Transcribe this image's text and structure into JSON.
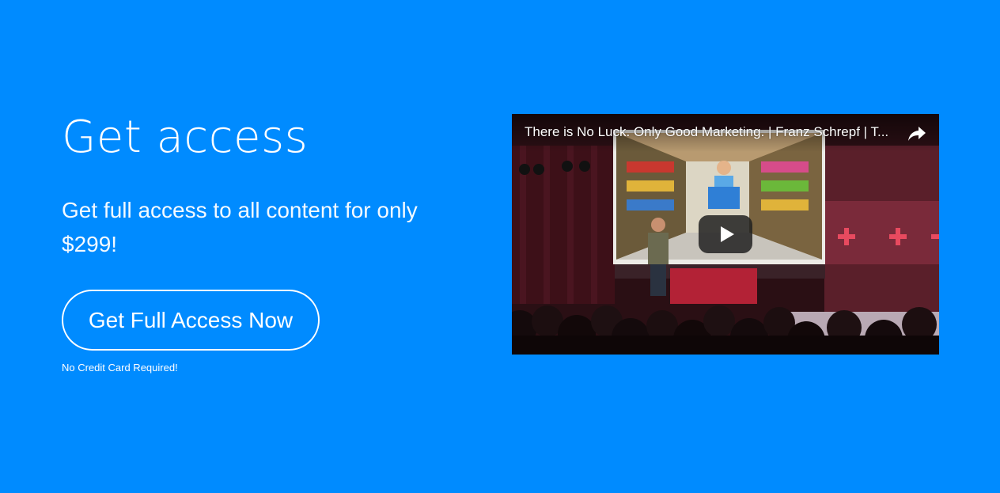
{
  "page": {
    "background_color": "#008bff"
  },
  "hero": {
    "heading": "Get access",
    "subtext": "Get full access to all content for only $299!",
    "cta_label": "Get Full Access Now",
    "cta_note": "No Credit Card Required!"
  },
  "video": {
    "title": "There is No Luck. Only Good Marketing. | Franz Schrepf | T...",
    "share_icon": "share-arrow-icon",
    "play_icon": "play-icon"
  }
}
